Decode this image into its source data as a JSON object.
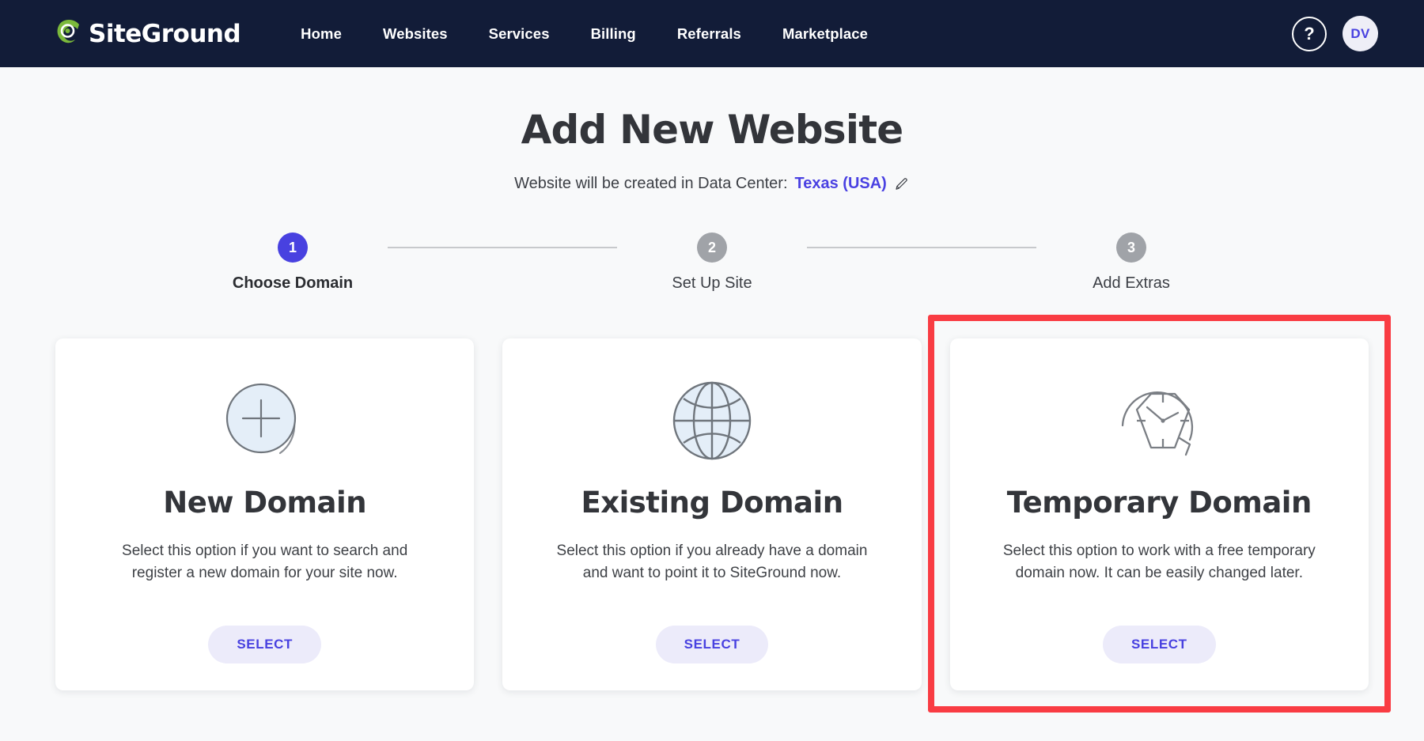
{
  "header": {
    "logo_text": "SiteGround",
    "nav": [
      {
        "label": "Home"
      },
      {
        "label": "Websites"
      },
      {
        "label": "Services"
      },
      {
        "label": "Billing"
      },
      {
        "label": "Referrals"
      },
      {
        "label": "Marketplace"
      }
    ],
    "help_glyph": "?",
    "avatar_initials": "DV",
    "bg_color": "#121c38",
    "logo_accent_color": "#7bb93b"
  },
  "main": {
    "title": "Add New Website",
    "datacenter": {
      "prefix": "Website will be created in Data Center:",
      "value": "Texas (USA)",
      "edit_icon": "pencil-icon",
      "value_color": "#4a41e2"
    },
    "stepper": {
      "steps": [
        {
          "number": "1",
          "label": "Choose Domain",
          "state": "active"
        },
        {
          "number": "2",
          "label": "Set Up Site",
          "state": "inactive"
        },
        {
          "number": "3",
          "label": "Add Extras",
          "state": "inactive"
        }
      ],
      "active_color": "#4841e0",
      "inactive_color": "#a0a3a8"
    },
    "cards": [
      {
        "icon": "plus-circle-icon",
        "title": "New Domain",
        "description": "Select this option if you want to search and register a new domain for your site now.",
        "button_label": "SELECT",
        "highlighted": false
      },
      {
        "icon": "globe-icon",
        "title": "Existing Domain",
        "description": "Select this option if you already have a domain and want to point it to SiteGround now.",
        "button_label": "SELECT",
        "highlighted": false
      },
      {
        "icon": "temporary-clock-icon",
        "title": "Temporary Domain",
        "description": "Select this option to work with a free temporary domain now. It can be easily changed later.",
        "button_label": "SELECT",
        "highlighted": true
      }
    ],
    "highlight_color": "#f93c43",
    "button_color": "#4841e0"
  }
}
